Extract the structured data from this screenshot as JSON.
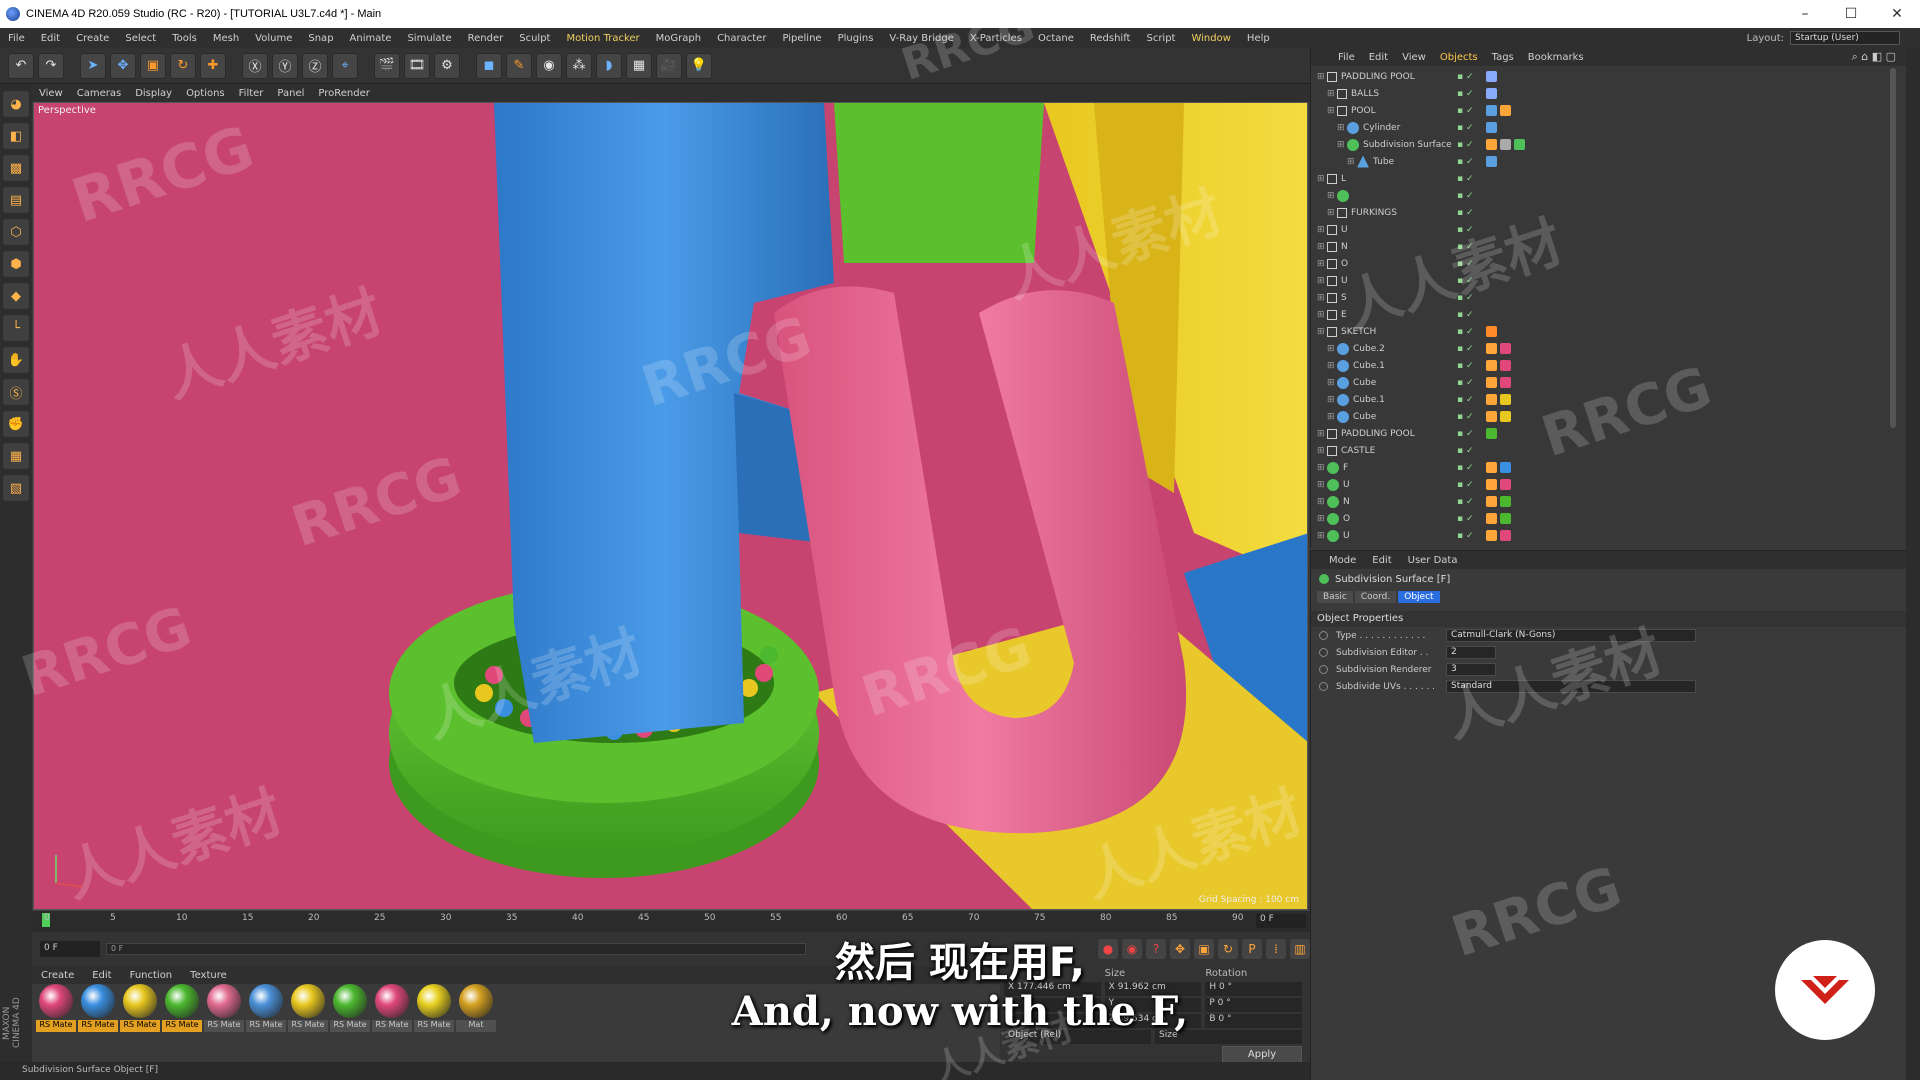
{
  "window": {
    "title": "CINEMA 4D R20.059 Studio (RC - R20) - [TUTORIAL U3L7.c4d *] - Main",
    "controls": [
      "–",
      "☐",
      "✕"
    ]
  },
  "menubar": {
    "items": [
      "File",
      "Edit",
      "Create",
      "Select",
      "Tools",
      "Mesh",
      "Volume",
      "Snap",
      "Animate",
      "Simulate",
      "Render",
      "Sculpt",
      "Motion Tracker",
      "MoGraph",
      "Character",
      "Pipeline",
      "Plugins",
      "V-Ray Bridge",
      "X-Particles",
      "Octane",
      "Redshift",
      "Script",
      "Window",
      "Help"
    ],
    "highlighted": [
      "Motion Tracker",
      "Window"
    ],
    "layout_label": "Layout:",
    "layout_value": "Startup (User)"
  },
  "viewport": {
    "menu": [
      "View",
      "Cameras",
      "Display",
      "Options",
      "Filter",
      "Panel",
      "ProRender"
    ],
    "camera_label": "Perspective",
    "grid_spacing": "Grid Spacing : 100 cm"
  },
  "timeline": {
    "ticks": [
      "0",
      "5",
      "10",
      "15",
      "20",
      "25",
      "30",
      "35",
      "40",
      "45",
      "50",
      "55",
      "60",
      "65",
      "70",
      "75",
      "80",
      "85",
      "90"
    ],
    "end_frame": "0 F",
    "current_frame": "0 F",
    "scrub_start": "0 F",
    "scrub_end": "90 F"
  },
  "material_manager": {
    "menu": [
      "Create",
      "Edit",
      "Function",
      "Texture"
    ],
    "materials": [
      {
        "label": "RS Mate",
        "color": "#e0487a",
        "tag": "orange"
      },
      {
        "label": "RS Mate",
        "color": "#3a8fe0",
        "tag": "orange"
      },
      {
        "label": "RS Mate",
        "color": "#e8c820",
        "tag": "orange"
      },
      {
        "label": "RS Mate",
        "color": "#4cb830",
        "tag": "orange"
      },
      {
        "label": "RS Mate",
        "color": "#e06a90",
        "tag": "plain"
      },
      {
        "label": "RS Mate",
        "color": "#4a90d8",
        "tag": "plain"
      },
      {
        "label": "RS Mate",
        "color": "#e8c820",
        "tag": "plain"
      },
      {
        "label": "RS Mate",
        "color": "#4cb830",
        "tag": "plain"
      },
      {
        "label": "RS Mate",
        "color": "#e0487a",
        "tag": "plain"
      },
      {
        "label": "RS Mate",
        "color": "#e8d020",
        "tag": "plain"
      },
      {
        "label": "Mat",
        "color": "#d4a020",
        "tag": "plain"
      }
    ]
  },
  "coordinates": {
    "headers": [
      "Size",
      "Rotation"
    ],
    "rows": [
      [
        "X  177.446 cm",
        "X  91.962 cm",
        "H  0 °"
      ],
      [
        "Y",
        "Y",
        "P  0 °"
      ],
      [
        "Z",
        "Z  89.534 cm",
        "B  0 °"
      ]
    ],
    "mode_left": "Object (Rel)",
    "mode_right": "Size",
    "apply_label": "Apply"
  },
  "statusbar": {
    "text": "Subdivision Surface Object [F]"
  },
  "object_manager": {
    "menu": [
      "File",
      "Edit",
      "View",
      "Objects",
      "Tags",
      "Bookmarks"
    ],
    "active_menu": "Objects",
    "objects": [
      {
        "name": "PADDLING POOL",
        "icon": "null",
        "indent": 0,
        "tags": [
          "#88aaff"
        ]
      },
      {
        "name": "BALLS",
        "icon": "null",
        "indent": 1,
        "tags": [
          "#88aaff"
        ]
      },
      {
        "name": "POOL",
        "icon": "null",
        "indent": 1,
        "tags": [
          "#5aa0e0",
          "#ffa53a"
        ]
      },
      {
        "name": "Cylinder",
        "icon": "cube",
        "indent": 2,
        "tags": [
          "#5aa0e0"
        ]
      },
      {
        "name": "Subdivision Surface",
        "icon": "gen",
        "indent": 2,
        "tags": [
          "#ffa53a",
          "#aaa",
          "#4fbf5a"
        ]
      },
      {
        "name": "Tube",
        "icon": "tube",
        "indent": 3,
        "tags": [
          "#5aa0e0"
        ]
      },
      {
        "name": "L",
        "icon": "null",
        "indent": 0,
        "tags": []
      },
      {
        "name": "",
        "icon": "gen",
        "indent": 1,
        "tags": []
      },
      {
        "name": "FURKINGS",
        "icon": "null",
        "indent": 1,
        "tags": []
      },
      {
        "name": "U",
        "icon": "null",
        "indent": 0,
        "tags": []
      },
      {
        "name": "N",
        "icon": "null",
        "indent": 0,
        "tags": []
      },
      {
        "name": "O",
        "icon": "null",
        "indent": 0,
        "tags": []
      },
      {
        "name": "U",
        "icon": "null",
        "indent": 0,
        "tags": []
      },
      {
        "name": "S",
        "icon": "null",
        "indent": 0,
        "tags": []
      },
      {
        "name": "E",
        "icon": "null",
        "indent": 0,
        "tags": []
      },
      {
        "name": "SKETCH",
        "icon": "null",
        "indent": 0,
        "tags": [
          "#ff8a2a"
        ]
      },
      {
        "name": "Cube.2",
        "icon": "cube",
        "indent": 1,
        "tags": [
          "#ffa53a",
          "#e0487a"
        ]
      },
      {
        "name": "Cube.1",
        "icon": "cube",
        "indent": 1,
        "tags": [
          "#ffa53a",
          "#e0487a"
        ]
      },
      {
        "name": "Cube",
        "icon": "cube",
        "indent": 1,
        "tags": [
          "#ffa53a",
          "#e0487a"
        ]
      },
      {
        "name": "Cube.1",
        "icon": "cube",
        "indent": 1,
        "tags": [
          "#ffa53a",
          "#e8c820"
        ]
      },
      {
        "name": "Cube",
        "icon": "cube",
        "indent": 1,
        "tags": [
          "#ffa53a",
          "#e8c820"
        ]
      },
      {
        "name": "PADDLING POOL",
        "icon": "null",
        "indent": 0,
        "tags": [
          "#4cb830"
        ]
      },
      {
        "name": "CASTLE",
        "icon": "null",
        "indent": 0,
        "tags": []
      },
      {
        "name": "F",
        "icon": "gen",
        "indent": 0,
        "tags": [
          "#ffa53a",
          "#3a8fe0"
        ]
      },
      {
        "name": "U",
        "icon": "gen",
        "indent": 0,
        "tags": [
          "#ffa53a",
          "#e0487a"
        ]
      },
      {
        "name": "N",
        "icon": "gen",
        "indent": 0,
        "tags": [
          "#ffa53a",
          "#4cb830"
        ]
      },
      {
        "name": "O",
        "icon": "gen",
        "indent": 0,
        "tags": [
          "#ffa53a",
          "#4cb830"
        ]
      },
      {
        "name": "U",
        "icon": "gen",
        "indent": 0,
        "tags": [
          "#ffa53a",
          "#e0487a"
        ]
      }
    ]
  },
  "attribute_manager": {
    "menu": [
      "Mode",
      "Edit",
      "User Data"
    ],
    "object_title": "Subdivision Surface [F]",
    "tabs": [
      "Basic",
      "Coord.",
      "Object"
    ],
    "active_tab": "Object",
    "section": "Object Properties",
    "properties": [
      {
        "label": "Type . . . . . . . . . . . .",
        "value": "Catmull-Clark (N-Gons)",
        "wide": true
      },
      {
        "label": "Subdivision Editor . .",
        "value": "2",
        "wide": false
      },
      {
        "label": "Subdivision Renderer",
        "value": "3",
        "wide": false
      },
      {
        "label": "Subdivide UVs . . . . . .",
        "value": "Standard",
        "wide": true
      }
    ]
  },
  "subtitles": {
    "chinese": "然后 现在用F,",
    "english": "And, now with the F,"
  },
  "watermark": {
    "brand": "RRCG",
    "site": "人人素材"
  }
}
